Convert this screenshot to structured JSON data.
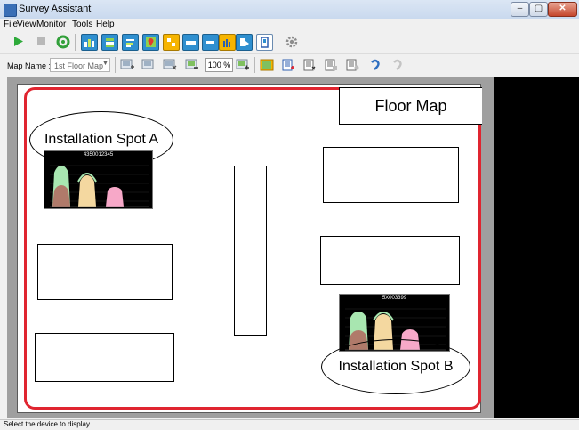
{
  "window": {
    "title": "Survey Assistant",
    "min_label": "–",
    "max_label": "▢",
    "close_label": "✕"
  },
  "menu": [
    {
      "label": "File"
    },
    {
      "label": "View"
    },
    {
      "label": "Monitor"
    },
    {
      "label": "Tools"
    },
    {
      "label": "Help"
    }
  ],
  "toolbar2": {
    "map_name_label": "Map Name :",
    "map_name_value": "1st Floor Map",
    "zoom_value": "100 %"
  },
  "canvas": {
    "floor_map_label": "Floor Map",
    "spot_a_label": "Installation Spot A",
    "spot_b_label": "Installation Spot B",
    "chart_a_title": "4350012345",
    "chart_b_title": "5X003399"
  },
  "status": {
    "text": "Select the device to display."
  },
  "colors": {
    "accent_red": "#e02530",
    "play_green": "#2eaa3a",
    "chart_green": "#a8e6b0",
    "chart_beige": "#f4d8a0",
    "chart_pink": "#f7a8c8",
    "chart_brown": "#b07a6a"
  }
}
